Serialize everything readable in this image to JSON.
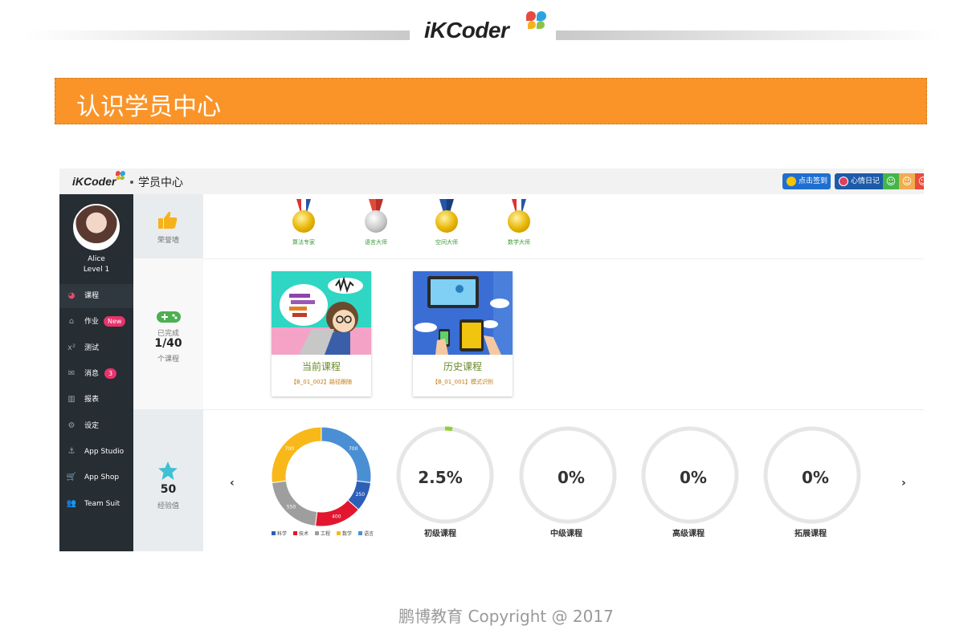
{
  "slide": {
    "logo_text": "iKCoder",
    "banner_title": "认识学员中心",
    "footer": "鹏博教育    Copyright @ 2017"
  },
  "app": {
    "logo_text": "iKCoder",
    "title": "学员中心",
    "sign_button": "点击签到",
    "mood_label": "心情日记",
    "mood_faces": [
      "☺",
      "☺",
      "☺"
    ]
  },
  "user": {
    "name": "Alice",
    "level": "Level 1"
  },
  "nav": [
    {
      "label": "课程",
      "icon": "dashboard-icon",
      "glyph": "◕",
      "active": true
    },
    {
      "label": "作业",
      "icon": "home-icon",
      "glyph": "⌂",
      "badge": "New"
    },
    {
      "label": "测试",
      "icon": "superscript-icon",
      "glyph": "x²"
    },
    {
      "label": "消息",
      "icon": "mail-icon",
      "glyph": "✉",
      "badge": "3"
    },
    {
      "label": "报表",
      "icon": "bar-chart-icon",
      "glyph": "▥"
    },
    {
      "label": "设定",
      "icon": "gears-icon",
      "glyph": "⚙"
    },
    {
      "label": "App Studio",
      "icon": "anchor-icon",
      "glyph": "⚓"
    },
    {
      "label": "App Shop",
      "icon": "cart-icon",
      "glyph": "🛒"
    },
    {
      "label": "Team Suit",
      "icon": "users-icon",
      "glyph": "👥"
    }
  ],
  "stats": {
    "honor_label": "荣誉墙",
    "completed_label": "已完成",
    "completed_value": "1/40",
    "completed_unit": "个课程",
    "xp_value": "50",
    "xp_label": "经验值"
  },
  "medals": [
    {
      "label": "算法专家",
      "type": "gold"
    },
    {
      "label": "语言大师",
      "type": "silver"
    },
    {
      "label": "空间大师",
      "type": "gold"
    },
    {
      "label": "数学大师",
      "type": "gold"
    }
  ],
  "courses": [
    {
      "title": "当前课程",
      "code": "【B_01_002】路径跟随"
    },
    {
      "title": "历史课程",
      "code": "【B_01_001】模式识别"
    }
  ],
  "chart_data": [
    {
      "type": "pie",
      "categories": [
        "科学",
        "技术",
        "工程",
        "数学",
        "语言"
      ],
      "values": [
        250,
        400,
        550,
        700,
        700
      ],
      "colors": [
        "#2e5fb8",
        "#e2162e",
        "#9e9e9e",
        "#f9b819",
        "#4a8fd4"
      ],
      "legend_position": "bottom"
    },
    {
      "type": "pie",
      "label": "初级课程",
      "value_text": "2.5%",
      "value": 2.5,
      "max": 100
    },
    {
      "type": "pie",
      "label": "中级课程",
      "value_text": "0%",
      "value": 0,
      "max": 100
    },
    {
      "type": "pie",
      "label": "高级课程",
      "value_text": "0%",
      "value": 0,
      "max": 100
    },
    {
      "type": "pie",
      "label": "拓展课程",
      "value_text": "0%",
      "value": 0,
      "max": 100
    }
  ],
  "nav_arrows": {
    "prev": "‹",
    "next": "›"
  }
}
